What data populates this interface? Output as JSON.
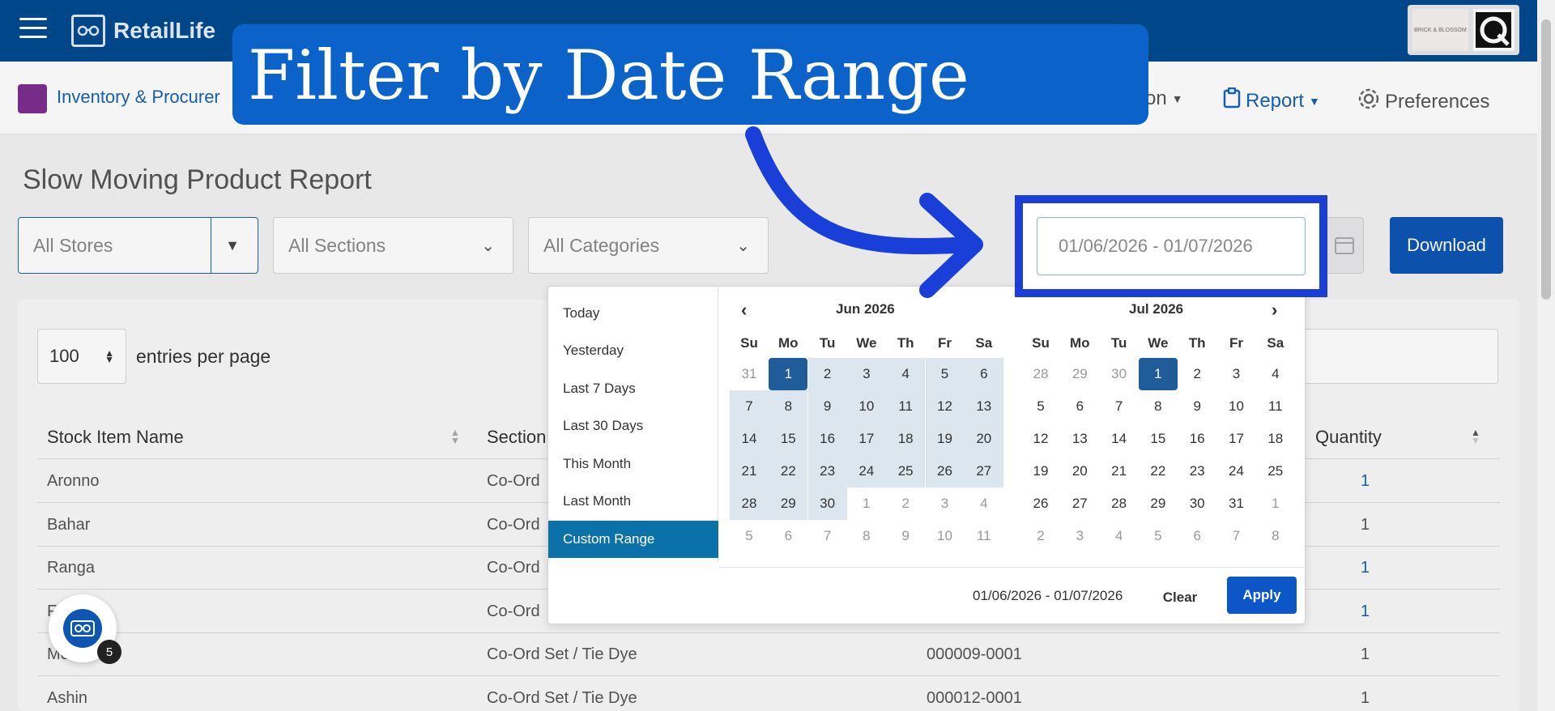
{
  "app": {
    "name": "RetailLife",
    "brand_badge_text": "BRICK & BLOSSOM"
  },
  "subnav": {
    "module_name": "Inventory & Procurer",
    "items": [
      {
        "label": "on",
        "icon": "chevron-down-icon"
      },
      {
        "label": "Report",
        "icon": "clipboard-icon"
      },
      {
        "label": "Preferences",
        "icon": "gear-icon"
      }
    ]
  },
  "annotation": {
    "banner_text": "Filter by Date Range"
  },
  "page": {
    "title": "Slow Moving Product Report",
    "filters": {
      "stores": "All Stores",
      "sections": "All Sections",
      "categories": "All Categories"
    },
    "date_range_value": "01/06/2026 - 01/07/2026",
    "download_label": "Download",
    "entries": {
      "value": "100",
      "label": "entries per page"
    }
  },
  "table": {
    "headers": [
      "Stock Item Name",
      "Section",
      "Quantity"
    ],
    "rows": [
      {
        "name": "Aronno",
        "section": "Co-Ord",
        "code": "",
        "qty": "1"
      },
      {
        "name": "Bahar",
        "section": "Co-Ord",
        "code": "",
        "qty": "1"
      },
      {
        "name": "Ranga",
        "section": "Co-Ord",
        "code": "",
        "qty": "1"
      },
      {
        "name": "F",
        "section": "Co-Ord",
        "code": "",
        "qty": "1"
      },
      {
        "name": "Mo",
        "section": "Co-Ord Set / Tie Dye",
        "code": "000009-0001",
        "qty": "1"
      },
      {
        "name": "Ashin",
        "section": "Co-Ord Set / Tie Dye",
        "code": "000012-0001",
        "qty": "1"
      }
    ]
  },
  "picker": {
    "ranges": [
      "Today",
      "Yesterday",
      "Last 7 Days",
      "Last 30 Days",
      "This Month",
      "Last Month",
      "Custom Range"
    ],
    "active_range": "Custom Range",
    "weekdays": [
      "Su",
      "Mo",
      "Tu",
      "We",
      "Th",
      "Fr",
      "Sa"
    ],
    "left_month": "Jun 2026",
    "right_month": "Jul 2026",
    "left_days": [
      "31",
      "1",
      "2",
      "3",
      "4",
      "5",
      "6",
      "7",
      "8",
      "9",
      "10",
      "11",
      "12",
      "13",
      "14",
      "15",
      "16",
      "17",
      "18",
      "19",
      "20",
      "21",
      "22",
      "23",
      "24",
      "25",
      "26",
      "27",
      "28",
      "29",
      "30",
      "1",
      "2",
      "3",
      "4",
      "5",
      "6",
      "7",
      "8",
      "9",
      "10",
      "11"
    ],
    "right_days": [
      "28",
      "29",
      "30",
      "1",
      "2",
      "3",
      "4",
      "5",
      "6",
      "7",
      "8",
      "9",
      "10",
      "11",
      "12",
      "13",
      "14",
      "15",
      "16",
      "17",
      "18",
      "19",
      "20",
      "21",
      "22",
      "23",
      "24",
      "25",
      "26",
      "27",
      "28",
      "29",
      "30",
      "31",
      "1",
      "2",
      "3",
      "4",
      "5",
      "6",
      "7",
      "8"
    ],
    "footer_range": "01/06/2026 - 01/07/2026",
    "clear_label": "Clear",
    "apply_label": "Apply"
  },
  "widget": {
    "count": "5"
  },
  "colors": {
    "topbar": "#004a8f",
    "accent": "#0d56b3",
    "selected_day": "#1f5c99",
    "highlight": "#1a3fd8",
    "banner": "#0b63c9"
  }
}
